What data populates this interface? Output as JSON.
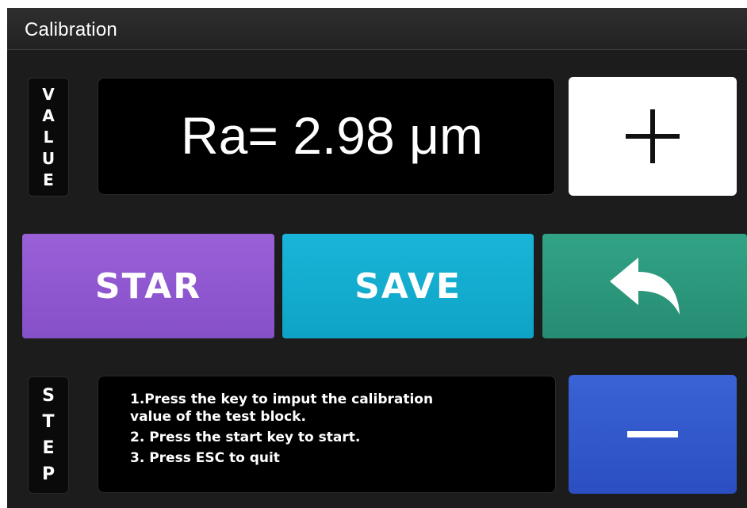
{
  "window": {
    "title": "Calibration"
  },
  "value_panel": {
    "side_label_letters": [
      "V",
      "A",
      "L",
      "U",
      "E"
    ],
    "reading": "Ra= 2.98 μm"
  },
  "buttons": {
    "plus_symbol": "+",
    "start_label": "STAR",
    "save_label": "SAVE",
    "back_icon": "return-arrow-icon",
    "minus_symbol": "−"
  },
  "step_panel": {
    "side_label_letters": [
      "S",
      "T",
      "E",
      "P"
    ],
    "steps": [
      "1.Press the key to imput the calibration value of the test block.",
      "2. Press the start key to start.",
      "3. Press ESC to quit"
    ]
  },
  "colors": {
    "background": "#1c1c1c",
    "start": "#9058d0",
    "save": "#13acd0",
    "back": "#2c977c",
    "minus": "#3259cc",
    "plus": "#ffffff"
  }
}
